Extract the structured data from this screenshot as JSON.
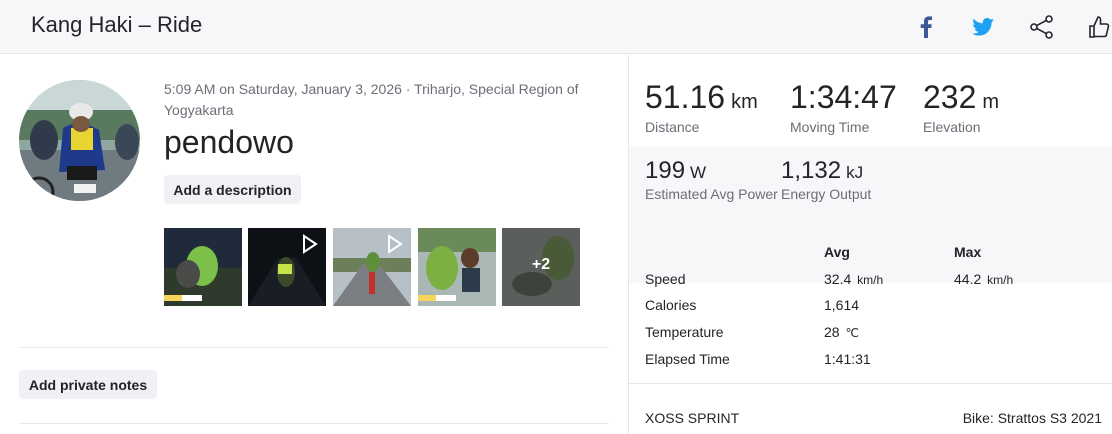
{
  "header": {
    "title": "Kang Haki – Ride",
    "icons": [
      "facebook-icon",
      "twitter-icon",
      "share-icon",
      "thumbs-up-icon"
    ]
  },
  "activity": {
    "meta": "5:09 AM on Saturday, January 3, 2026 · Triharjo, Special Region of Yogyakarta",
    "name": "pendowo",
    "add_description_label": "Add a description",
    "add_private_notes_label": "Add private notes",
    "more_photos_label": "+2"
  },
  "stats": {
    "distance": {
      "value": "51.16",
      "unit": "km",
      "label": "Distance"
    },
    "moving_time": {
      "value": "1:34:47",
      "label": "Moving Time"
    },
    "elevation": {
      "value": "232",
      "unit": "m",
      "label": "Elevation"
    },
    "power": {
      "value": "199",
      "unit": "W",
      "label": "Estimated Avg Power"
    },
    "energy": {
      "value": "1,132",
      "unit": "kJ",
      "label": "Energy Output"
    }
  },
  "table": {
    "headers": [
      "Avg",
      "Max"
    ],
    "rows": [
      {
        "label": "Speed",
        "avg": "32.4",
        "avg_unit": "km/h",
        "max": "44.2",
        "max_unit": "km/h"
      },
      {
        "label": "Calories",
        "avg": "1,614"
      },
      {
        "label": "Temperature",
        "avg": "28",
        "avg_unit": "℃"
      },
      {
        "label": "Elapsed Time",
        "avg": "1:41:31"
      }
    ]
  },
  "gear": {
    "device": "XOSS SPRINT",
    "bike": "Bike: Strattos S3 2021"
  },
  "colors": {
    "facebook": "#3b5998",
    "twitter": "#1da1f2",
    "text": "#242428",
    "muted": "#6d6d78"
  }
}
